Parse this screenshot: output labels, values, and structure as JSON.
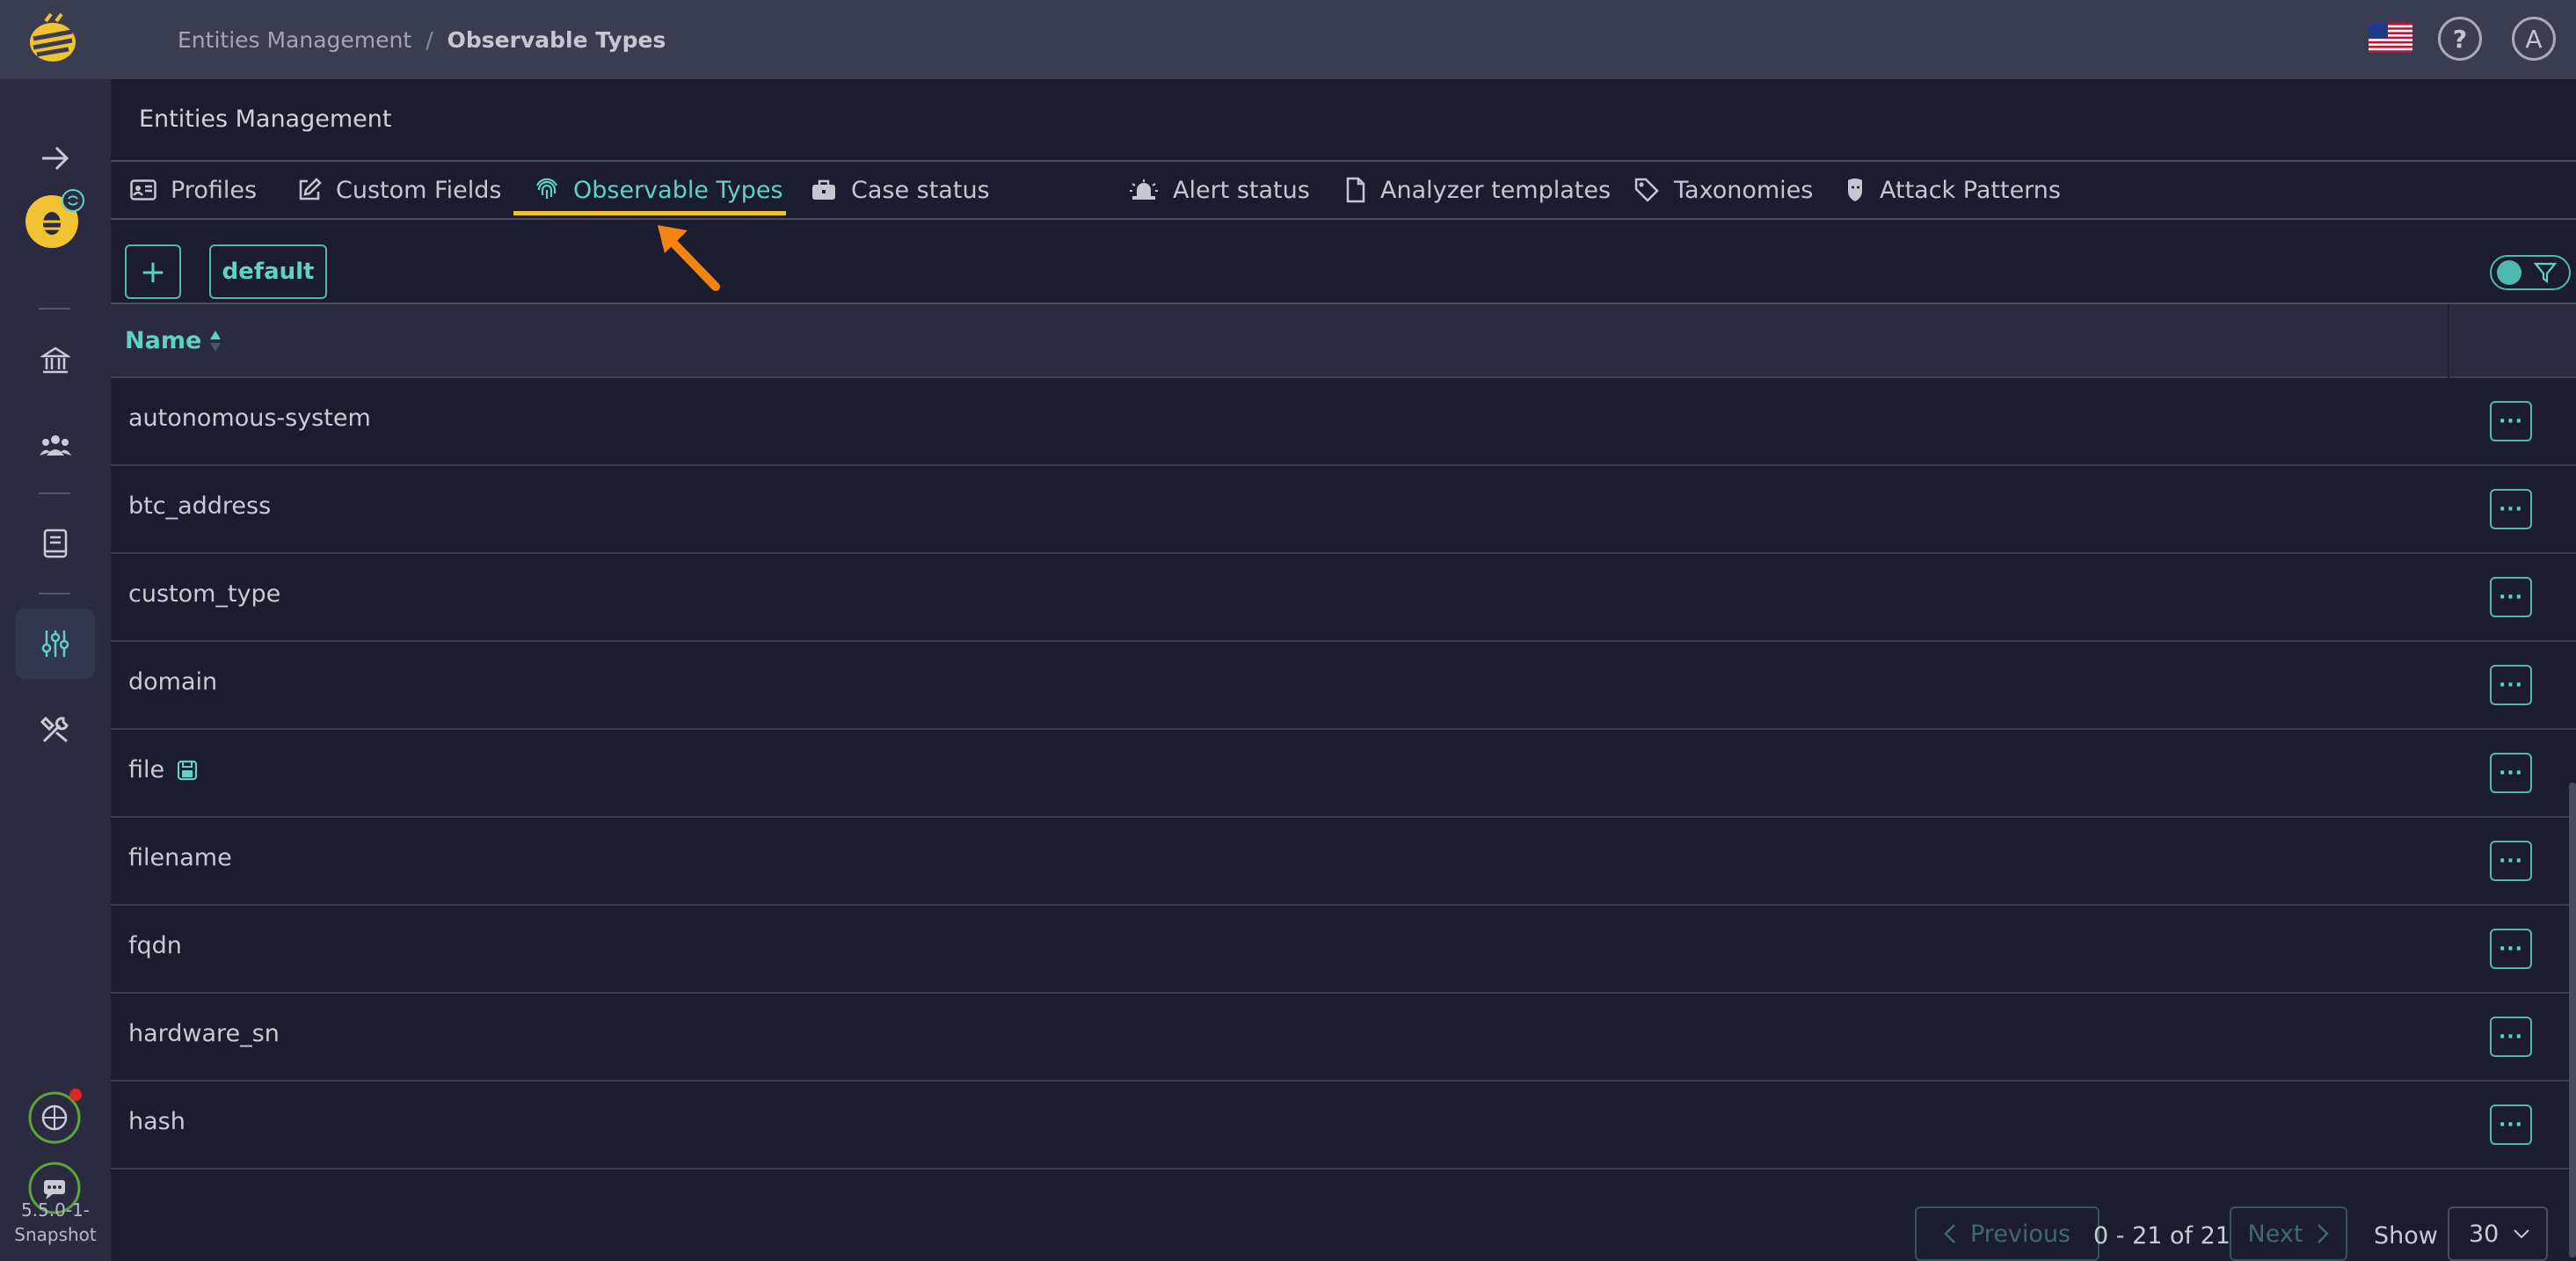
{
  "topbar": {
    "breadcrumb": [
      "Entities Management",
      "Observable Types"
    ],
    "breadcrumb_separator": "/",
    "avatar_initial": "A",
    "help_symbol": "?"
  },
  "sidebar": {
    "items": [
      {
        "icon": "arrow-right-icon"
      },
      {
        "icon": "bee-avatar-icon"
      },
      {
        "icon": "bank-icon"
      },
      {
        "icon": "users-icon"
      },
      {
        "icon": "book-icon"
      },
      {
        "icon": "sliders-icon",
        "active": true
      },
      {
        "icon": "tools-icon"
      },
      {
        "icon": "brain-icon"
      },
      {
        "icon": "chat-icon"
      }
    ],
    "version": "5.5.0-1-Snapshot",
    "version_line1": "5.5.0-1-",
    "version_line2": "Snapshot"
  },
  "page": {
    "title": "Entities Management"
  },
  "tabs": [
    {
      "label": "Profiles",
      "icon": "id-card-icon"
    },
    {
      "label": "Custom Fields",
      "icon": "edit-icon"
    },
    {
      "label": "Observable Types",
      "icon": "fingerprint-icon",
      "active": true
    },
    {
      "label": "Case status",
      "icon": "briefcase-icon"
    },
    {
      "label": "Alert status",
      "icon": "alarm-icon"
    },
    {
      "label": "Analyzer templates",
      "icon": "file-icon"
    },
    {
      "label": "Taxonomies",
      "icon": "tags-icon"
    },
    {
      "label": "Attack Patterns",
      "icon": "mask-icon"
    }
  ],
  "toolbar": {
    "add_label": "+",
    "default_label": "default"
  },
  "table": {
    "column_name": "Name",
    "sort": "ascending",
    "rows": [
      {
        "name": "autonomous-system"
      },
      {
        "name": "btc_address"
      },
      {
        "name": "custom_type"
      },
      {
        "name": "domain"
      },
      {
        "name": "file",
        "badge": "attachment-icon"
      },
      {
        "name": "filename"
      },
      {
        "name": "fqdn"
      },
      {
        "name": "hardware_sn"
      },
      {
        "name": "hash"
      }
    ],
    "action_label": "···"
  },
  "pagination": {
    "previous_label": "Previous",
    "next_label": "Next",
    "info": "0 - 21 of 21",
    "show_label": "Show",
    "page_size": "30"
  },
  "colors": {
    "accent": "#5fd2c8",
    "active_tab_underline": "#f1c232",
    "annotation_arrow": "#f5830f",
    "background": "#1c1c30",
    "topbar": "#3a3c52",
    "sidebar": "#2a2b40"
  }
}
